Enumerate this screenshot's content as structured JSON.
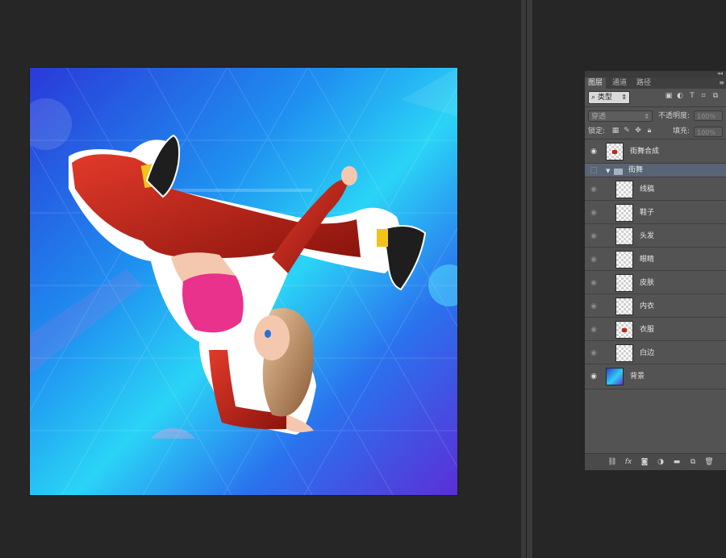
{
  "panel": {
    "tabs": [
      {
        "label": "图层",
        "active": true
      },
      {
        "label": "通道",
        "active": false
      },
      {
        "label": "路径",
        "active": false
      }
    ],
    "filter": {
      "label": "类型",
      "icons": [
        "image-filter-icon",
        "adjustment-filter-icon",
        "type-filter-icon",
        "shape-filter-icon",
        "smart-object-filter-icon"
      ]
    },
    "blend_mode": "穿透",
    "opacity_label": "不透明度:",
    "opacity_value": "100%",
    "lock_label": "锁定:",
    "fill_label": "填充:",
    "fill_value": "100%",
    "layers": [
      {
        "name": "街舞合成",
        "visible": true,
        "type": "smart"
      },
      {
        "name": "街舞",
        "visible": false,
        "type": "group",
        "expanded": true
      },
      {
        "name": "线稿",
        "visible": false,
        "type": "child"
      },
      {
        "name": "鞋子",
        "visible": false,
        "type": "child"
      },
      {
        "name": "头发",
        "visible": false,
        "type": "child"
      },
      {
        "name": "眼睛",
        "visible": false,
        "type": "child"
      },
      {
        "name": "皮肤",
        "visible": false,
        "type": "child"
      },
      {
        "name": "内衣",
        "visible": false,
        "type": "child"
      },
      {
        "name": "衣服",
        "visible": false,
        "type": "child"
      },
      {
        "name": "白边",
        "visible": false,
        "type": "child"
      },
      {
        "name": "背景",
        "visible": true,
        "type": "background"
      }
    ],
    "bottom_icons": [
      "link-icon",
      "fx-icon",
      "mask-icon",
      "adjustment-icon",
      "folder-icon",
      "new-layer-icon",
      "trash-icon"
    ]
  },
  "colors": {
    "workspace": "#262626",
    "panel": "#535353",
    "group_highlight": "#596575",
    "clothes_red": "#c0281c",
    "top_pink": "#e8328c"
  }
}
